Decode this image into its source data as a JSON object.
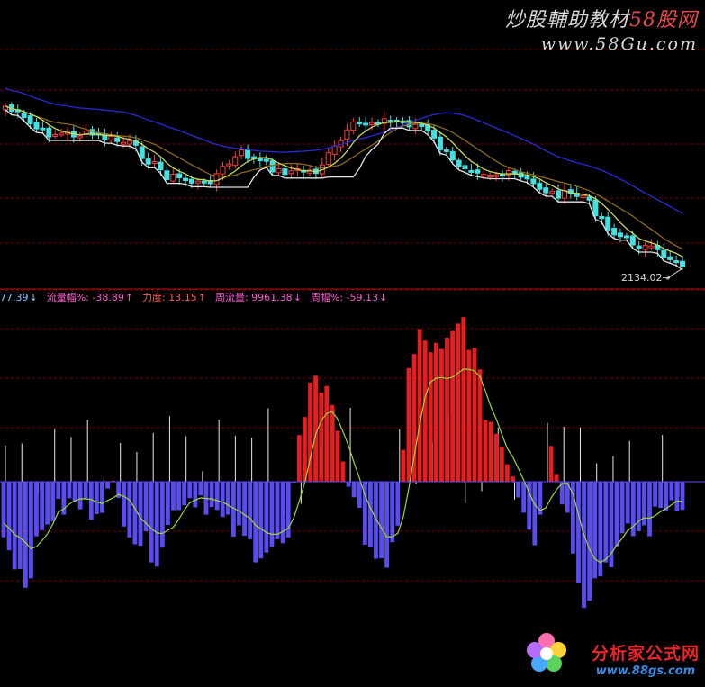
{
  "watermark_top": {
    "title_prefix": "炒股輔助教材",
    "title_accent": "58股网",
    "url": "www.58Gu.com"
  },
  "price_marker": "2134.02",
  "indicator_bar": [
    {
      "text": "77.39",
      "arrow": "↓",
      "color": "#7ecbff"
    },
    {
      "text": "流量幅%: -38.89",
      "arrow": "↑",
      "color": "#ff5ad2"
    },
    {
      "text": "力度: 13.15",
      "arrow": "↑",
      "color": "#ff5a5a"
    },
    {
      "text": "周流量: 9961.38",
      "arrow": "↓",
      "color": "#ff5ad2"
    },
    {
      "text": "周幅%: -59.13",
      "arrow": "↓",
      "color": "#ff5ad2"
    }
  ],
  "watermark_bottom": {
    "title": "分析家公式网",
    "url": "www.88gs.com"
  },
  "colors": {
    "up_candle": "#ff3b3b",
    "down_candle": "#44e0e0",
    "ma_slow": "#2a2ad6",
    "ma_mid": "#8a6a1e",
    "ma_fast": "#c8d860",
    "support_line": "#e6e6e6",
    "pos_bar": "#e61e1e",
    "neg_bar": "#5a4cf0",
    "osc_line": "#9ad83a",
    "grid": "#7a0000"
  }
}
